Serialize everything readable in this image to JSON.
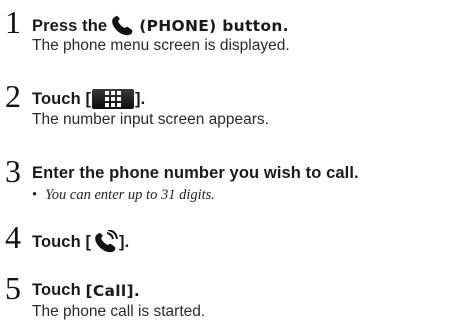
{
  "steps": [
    {
      "number": "1",
      "pre": "Press the",
      "post": "(PHONE) button.",
      "desc": "The phone menu screen is displayed.",
      "icon": "phone-handset-icon"
    },
    {
      "number": "2",
      "pre": "Touch [",
      "post": "].",
      "desc": "The number input screen appears.",
      "icon": "keypad-icon"
    },
    {
      "number": "3",
      "text": "Enter the phone number you wish to call.",
      "bullet": "•",
      "note": "You can enter up to 31 digits."
    },
    {
      "number": "4",
      "pre": "Touch [",
      "post": "].",
      "icon": "call-handset-icon"
    },
    {
      "number": "5",
      "pre": "Touch ",
      "post": "[Call].",
      "desc": "The phone call is started."
    }
  ]
}
